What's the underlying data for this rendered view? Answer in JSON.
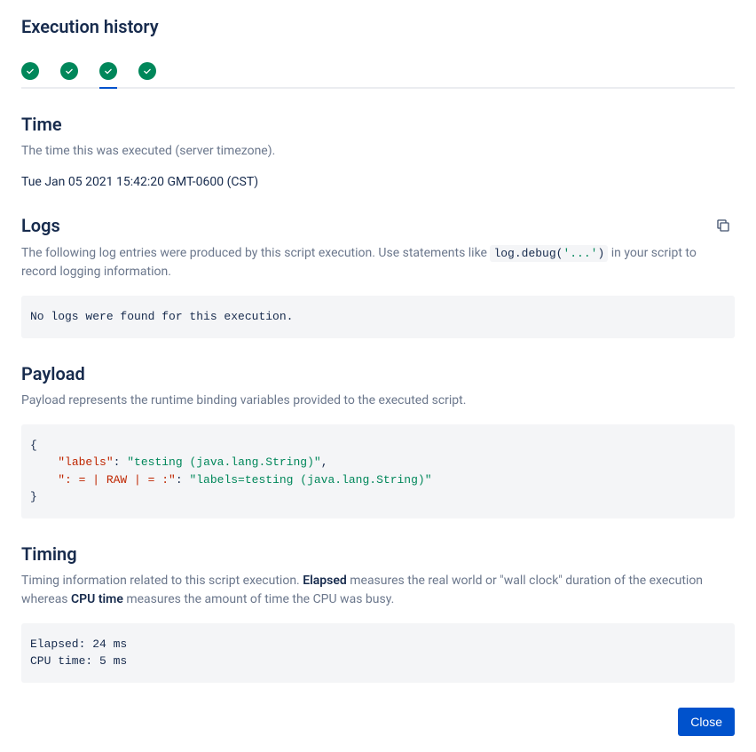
{
  "page_title": "Execution history",
  "tabs": [
    {
      "status": "success"
    },
    {
      "status": "success"
    },
    {
      "status": "success"
    },
    {
      "status": "success"
    }
  ],
  "active_tab_index": 2,
  "time": {
    "heading": "Time",
    "description": "The time this was executed (server timezone).",
    "value": "Tue Jan 05 2021 15:42:20 GMT-0600 (CST)"
  },
  "logs": {
    "heading": "Logs",
    "desc_pre": "The following log entries were produced by this script execution. Use statements like ",
    "code_fn": "log.debug(",
    "code_arg": "'...'",
    "code_close": ")",
    "desc_post": " in your script to record logging information.",
    "no_logs_text": "No logs were found for this execution."
  },
  "payload": {
    "heading": "Payload",
    "description": "Payload represents the runtime binding variables provided to the executed script.",
    "json": {
      "key1": "\"labels\"",
      "val1": "\"testing (java.lang.String)\"",
      "key2": "\": = | RAW | = :\"",
      "val2": "\"labels=testing (java.lang.String)\""
    }
  },
  "timing": {
    "heading": "Timing",
    "desc_p1": "Timing information related to this script execution. ",
    "elapsed_label": "Elapsed",
    "desc_p2": " measures the real world or \"wall clock\" duration of the execution whereas ",
    "cpu_label": "CPU time",
    "desc_p3": " measures the amount of time the CPU was busy.",
    "elapsed_line": "Elapsed: 24 ms",
    "cpu_line": "CPU time: 5 ms"
  },
  "close_label": "Close"
}
